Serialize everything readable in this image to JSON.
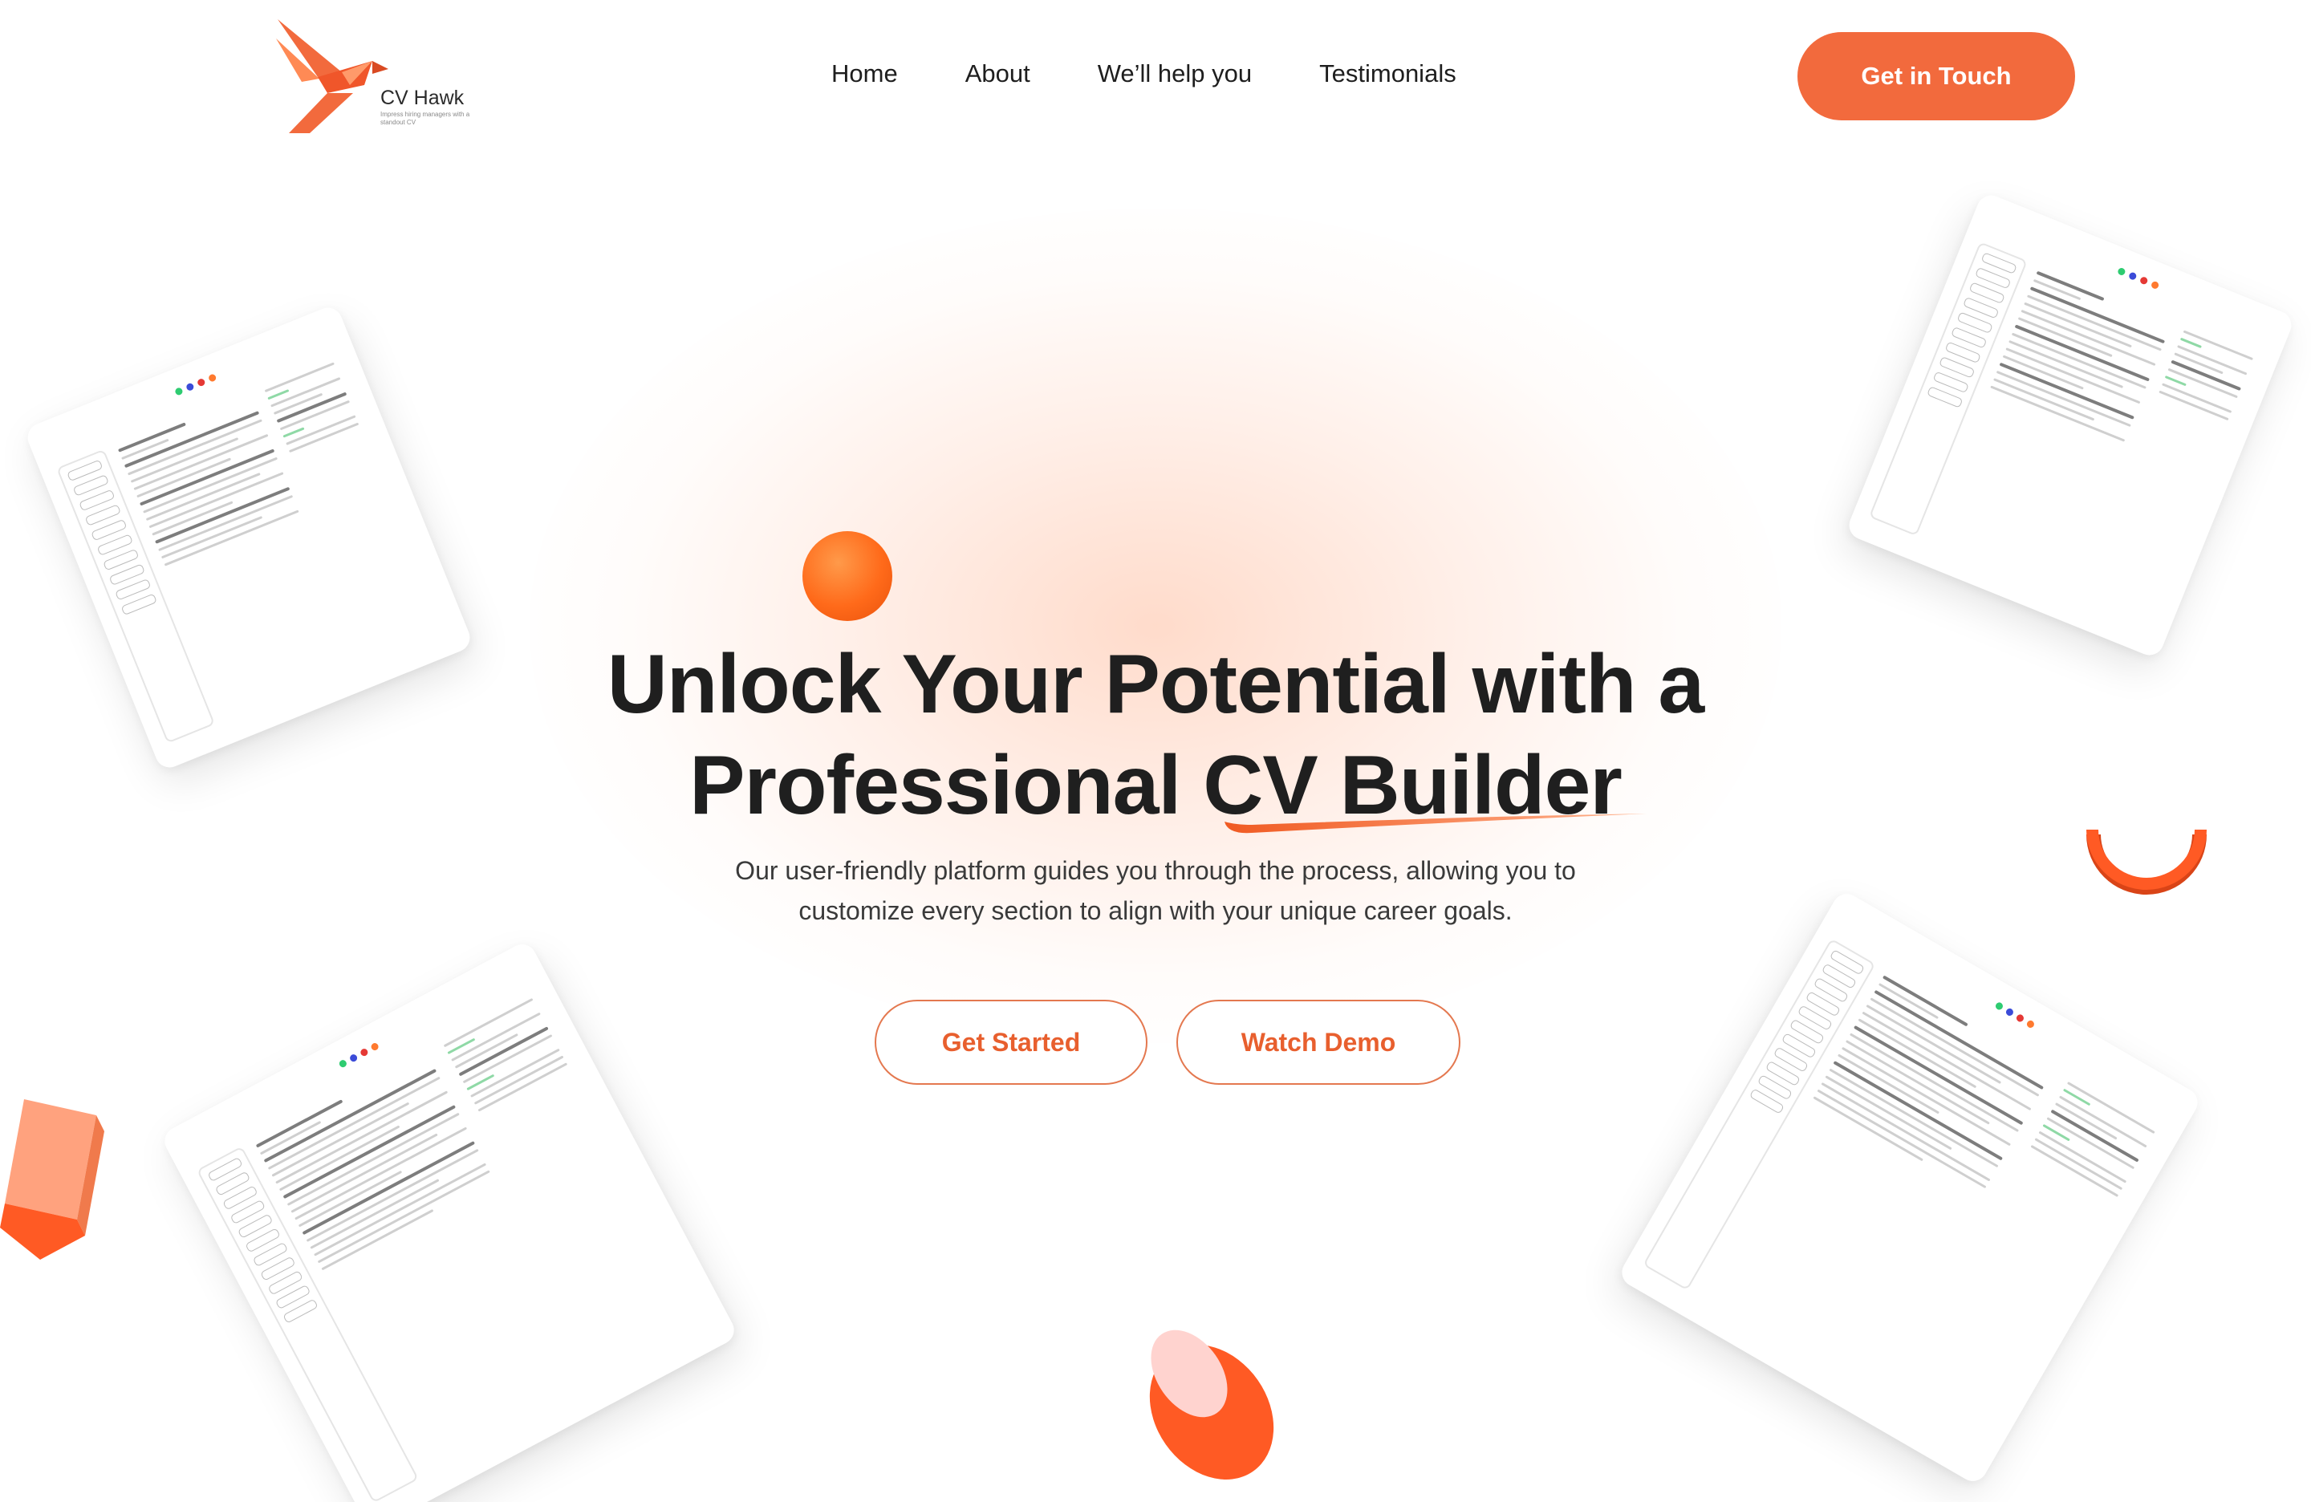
{
  "brand": {
    "name": "CV Hawk",
    "tagline": "Impress hiring managers with a standout CV",
    "accent": "#f26a3d"
  },
  "nav": {
    "items": [
      {
        "label": "Home"
      },
      {
        "label": "About"
      },
      {
        "label": "We’ll help you"
      },
      {
        "label": "Testimonials"
      }
    ],
    "cta_label": "Get in Touch"
  },
  "hero": {
    "headline_line1": "Unlock Your Potential with a",
    "headline_line2_prefix": "Professional ",
    "headline_highlight": "CV Builder",
    "subtext_line1": "Our user-friendly platform guides you through the process, allowing you to",
    "subtext_line2": "customize every section to align with your unique career goals.",
    "primary_button": "Get Started",
    "secondary_button": "Watch Demo"
  }
}
